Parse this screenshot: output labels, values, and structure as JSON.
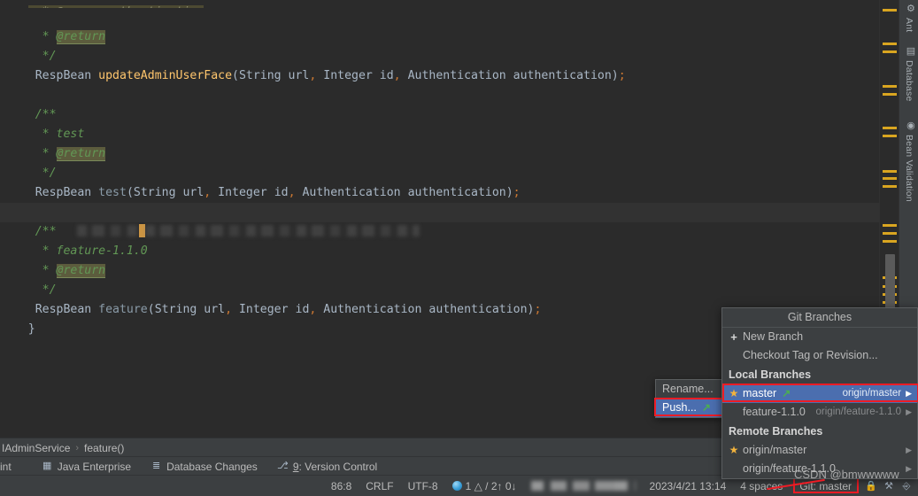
{
  "editor": {
    "lines": [
      {
        "type": "comment-cut",
        "text": "@param authentication"
      },
      {
        "type": "javadoc-tag",
        "prefix": "  * ",
        "tag": "@return"
      },
      {
        "type": "comment",
        "text": "  */"
      },
      {
        "type": "signature",
        "ret": "RespBean",
        "name": "updateAdminUserFace",
        "args": "(String url, Integer id, Authentication authentication);",
        "declared": false
      },
      {
        "type": "blank",
        "text": ""
      },
      {
        "type": "comment",
        "text": "  /**"
      },
      {
        "type": "comment",
        "text": "   * test"
      },
      {
        "type": "javadoc-tag",
        "prefix": "  * ",
        "tag": "@return"
      },
      {
        "type": "comment",
        "text": "  */"
      },
      {
        "type": "signature",
        "ret": "RespBean",
        "name": "test",
        "args": "(String url, Integer id, Authentication authentication);",
        "declared": true
      },
      {
        "type": "blank",
        "text": ""
      },
      {
        "type": "redacted",
        "prefix": "  /**"
      },
      {
        "type": "comment",
        "text": "   * feature-1.1.0"
      },
      {
        "type": "javadoc-tag",
        "prefix": "  * ",
        "tag": "@return"
      },
      {
        "type": "comment",
        "text": "  */"
      },
      {
        "type": "signature",
        "ret": "RespBean",
        "name": "feature",
        "args": "(String url, Integer id, Authentication authentication);",
        "declared": true
      },
      {
        "type": "brace",
        "text": "}"
      }
    ]
  },
  "right_strip": {
    "buttons": [
      {
        "label": "Ant",
        "icon": "ant-icon",
        "glyph": "⚙"
      },
      {
        "label": "Database",
        "icon": "database-icon",
        "glyph": "▤"
      },
      {
        "label": "Bean Validation",
        "icon": "bean-validation-icon",
        "glyph": "◉"
      }
    ]
  },
  "breadcrumb": {
    "items": [
      "IAdminService",
      "feature()"
    ],
    "separator": "›"
  },
  "tool_windows": {
    "items": [
      {
        "label": "int",
        "icon": "",
        "glyph": ""
      },
      {
        "label": "Java Enterprise",
        "icon": "java-enterprise-icon",
        "glyph": "▦"
      },
      {
        "label": "Database Changes",
        "icon": "database-changes-icon",
        "glyph": "≣"
      },
      {
        "label": "9: Version Control",
        "icon": "version-control-icon",
        "glyph": "⎇",
        "accesskey": "9"
      }
    ]
  },
  "status_bar": {
    "caret_position": "86:8",
    "line_separator": "CRLF",
    "encoding": "UTF-8",
    "inspection": "1 △ / 2↑ 0↓",
    "redacted_path": "",
    "timestamp": "2023/4/21 13:14",
    "indent": "4 spaces",
    "git_branch": "Git: master",
    "icons": [
      "lock-icon",
      "bug-icon",
      "memory-icon"
    ]
  },
  "git_popup": {
    "title": "Git Branches",
    "new_branch": "New Branch",
    "new_branch_icon": "plus-icon",
    "checkout": "Checkout Tag or Revision...",
    "local_header": "Local Branches",
    "local_branches": [
      {
        "name": "master",
        "tracking": "origin/master",
        "current": true,
        "selected": true,
        "has_outgoing": true,
        "star_icon": "star-icon",
        "arrow_icon": "chevron-right-icon"
      },
      {
        "name": "feature-1.1.0",
        "tracking": "origin/feature-1.1.0",
        "current": false,
        "selected": false,
        "has_outgoing": false,
        "star_icon": "",
        "arrow_icon": "chevron-right-icon"
      }
    ],
    "remote_header": "Remote Branches",
    "remote_branches": [
      {
        "name": "origin/master",
        "starred": true,
        "star_icon": "star-icon",
        "arrow_icon": "chevron-right-icon"
      },
      {
        "name": "origin/feature-1.1.0",
        "starred": false,
        "star_icon": "",
        "arrow_icon": "chevron-right-icon"
      }
    ]
  },
  "submenu": {
    "items": [
      {
        "label": "Rename...",
        "selected": false,
        "icon": ""
      },
      {
        "label": "Push...",
        "selected": true,
        "icon": "push-arrow-icon"
      }
    ]
  },
  "watermark": {
    "text": "CSDN @bmwwwww"
  },
  "colors": {
    "editor_bg": "#2b2b2b",
    "panel_bg": "#3c3f41",
    "selection_blue": "#4b6eaf",
    "highlight_red": "#ee1c25",
    "star_gold": "#f2b33d",
    "green_arrow": "#4caf50",
    "warn_marker": "#d9a520",
    "comment_green": "#629755",
    "method_orange": "#ffc66d"
  }
}
